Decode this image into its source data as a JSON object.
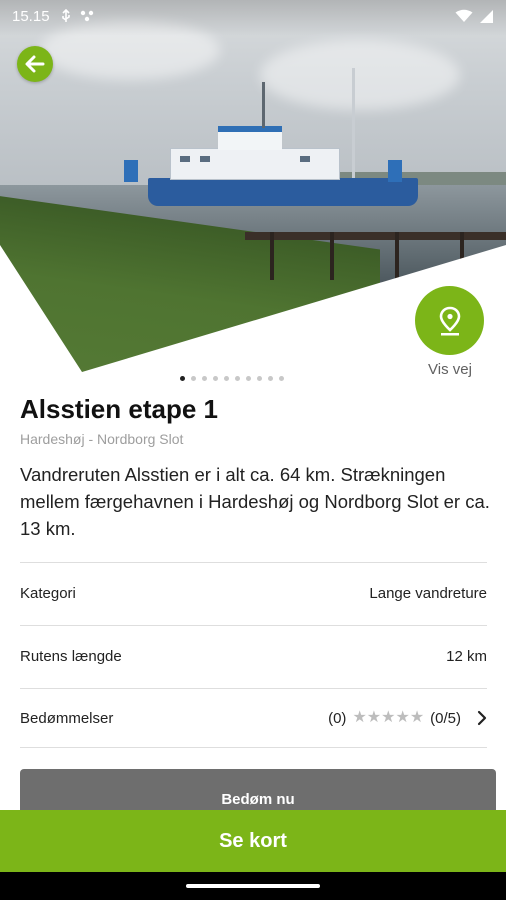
{
  "status_bar": {
    "time": "15.15"
  },
  "hero": {
    "alt": "Ferry at Hardeshøj harbour",
    "total_images": 10,
    "active_index": 0
  },
  "directions": {
    "label": "Vis vej"
  },
  "route": {
    "title": "Alsstien etape 1",
    "subtitle": "Hardeshøj - Nordborg Slot",
    "description": "Vandreruten Alsstien er i alt ca. 64 km. Strækningen mellem færgehavnen i Hardeshøj og Nordborg Slot er ca. 13 km."
  },
  "details": {
    "category_label": "Kategori",
    "category_value": "Lange vandreture",
    "length_label": "Rutens længde",
    "length_value": "12 km",
    "ratings_label": "Bedømmelser",
    "ratings_count": "(0)",
    "ratings_score": "(0/5)",
    "stars_filled": 0,
    "stars_total": 5
  },
  "buttons": {
    "rate_now": "Bedøm nu",
    "see_map": "Se kort"
  },
  "colors": {
    "accent": "#7cb518",
    "rate_button": "#6e6e6e",
    "star_empty": "#bdbdbd"
  }
}
